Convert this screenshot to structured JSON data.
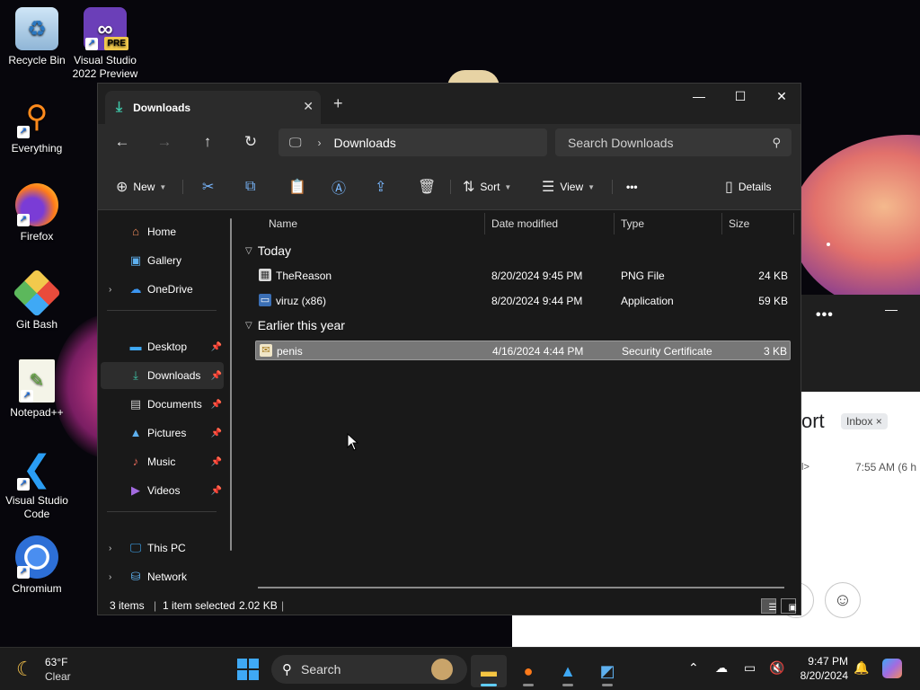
{
  "desktop": {
    "icons": [
      {
        "label": "Recycle Bin"
      },
      {
        "label": "Visual Studio 2022 Preview",
        "badge": "PRE"
      },
      {
        "label": "Everything"
      },
      {
        "label": "Firefox"
      },
      {
        "label": "Git Bash"
      },
      {
        "label": "Notepad++"
      },
      {
        "label": "Visual Studio Code"
      },
      {
        "label": "Chromium"
      }
    ]
  },
  "mail_window": {
    "title_fragment": "ort",
    "badge": "Inbox",
    "badge_close": "×",
    "arrow": "l>",
    "time": "7:55 AM (6 h",
    "dots": "•••",
    "minimize": "—"
  },
  "explorer": {
    "tab": {
      "label": "Downloads",
      "close": "✕",
      "new_tab": "+"
    },
    "window_controls": {
      "minimize": "—",
      "maximize": "☐",
      "close": "✕"
    },
    "address": {
      "crumb": "Downloads"
    },
    "search": {
      "placeholder": "Search Downloads"
    },
    "toolbar": {
      "new_label": "New",
      "sort_label": "Sort",
      "view_label": "View",
      "more_label": "•••",
      "details_label": "Details"
    },
    "nav": {
      "home": "Home",
      "gallery": "Gallery",
      "onedrive": "OneDrive",
      "desktop": "Desktop",
      "downloads": "Downloads",
      "documents": "Documents",
      "pictures": "Pictures",
      "music": "Music",
      "videos": "Videos",
      "this_pc": "This PC",
      "network": "Network"
    },
    "columns": {
      "name": "Name",
      "date": "Date modified",
      "type": "Type",
      "size": "Size"
    },
    "groups": [
      {
        "label": "Today",
        "files": [
          {
            "name": "TheReason",
            "date": "8/20/2024 9:45 PM",
            "type": "PNG File",
            "size": "24 KB"
          },
          {
            "name": "viruz (x86)",
            "date": "8/20/2024 9:44 PM",
            "type": "Application",
            "size": "59 KB"
          }
        ]
      },
      {
        "label": "Earlier this year",
        "files": [
          {
            "name": "penis",
            "date": "4/16/2024 4:44 PM",
            "type": "Security Certificate",
            "size": "3 KB",
            "selected": true
          }
        ]
      }
    ],
    "status": {
      "items": "3 items",
      "sep": "|",
      "selected": "1 item selected",
      "size": "2.02 KB",
      "sep2": "|"
    }
  },
  "taskbar": {
    "weather": {
      "temp": "63°F",
      "condition": "Clear"
    },
    "search_label": "Search",
    "clock": {
      "time": "9:47 PM",
      "date": "8/20/2024"
    }
  },
  "colors": {
    "accent": "#60cdff",
    "downloads_icon": "#3ec3a6",
    "selection": "#777777"
  }
}
